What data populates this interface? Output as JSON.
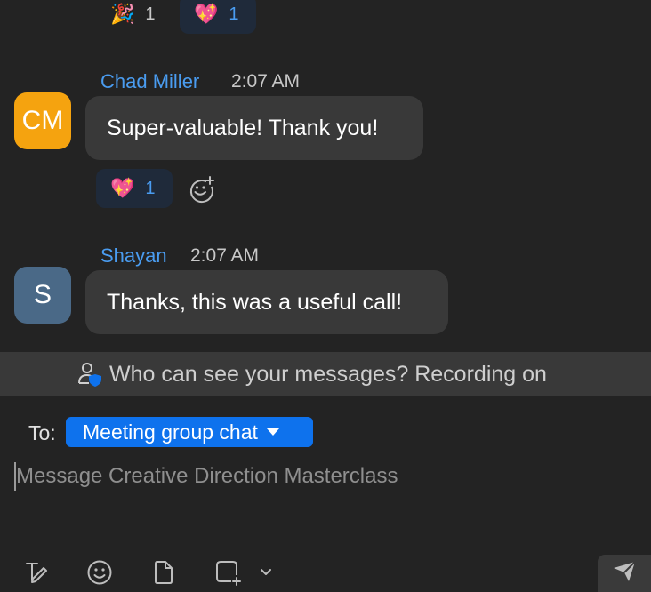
{
  "top_reactions": [
    {
      "emoji": "🎉",
      "count": "1"
    },
    {
      "emoji": "💖",
      "count": "1"
    }
  ],
  "messages": [
    {
      "initials": "CM",
      "avatar_color": "#f5a30f",
      "sender": "Chad Miller",
      "time": "2:07 AM",
      "text": "Super-valuable! Thank you!",
      "reaction": {
        "emoji": "💖",
        "count": "1"
      }
    },
    {
      "initials": "S",
      "avatar_color": "#4a6987",
      "sender": "Shayan",
      "time": "2:07 AM",
      "text": "Thanks, this was a useful call!"
    }
  ],
  "notice": {
    "text": "Who can see your messages? Recording on",
    "icon": "user-shield-icon"
  },
  "recipient": {
    "label": "To:",
    "value": "Meeting group chat"
  },
  "composer": {
    "placeholder": "Message Creative Direction Masterclass"
  },
  "toolbar": [
    {
      "icon": "format-text-icon"
    },
    {
      "icon": "emoji-icon"
    },
    {
      "icon": "file-icon"
    },
    {
      "icon": "screenshot-icon"
    },
    {
      "icon": "chevron-down-icon"
    },
    {
      "icon": "send-icon"
    }
  ],
  "colors": {
    "background": "#232323",
    "bubble": "#393939",
    "sender_name": "#4a9cf0",
    "accent": "#0e72ed",
    "reaction_highlight": "#1f2a3a"
  }
}
